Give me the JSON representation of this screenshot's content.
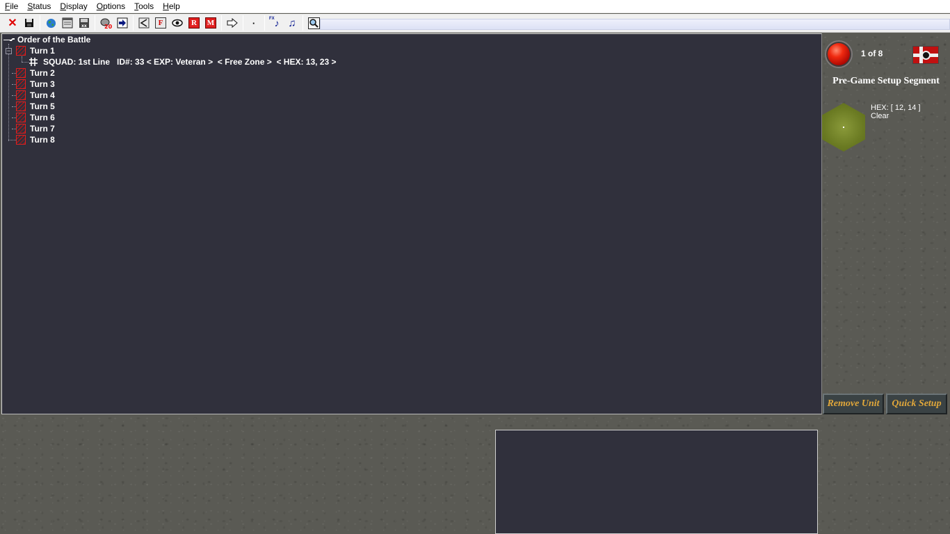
{
  "menu": [
    "File",
    "Status",
    "Display",
    "Options",
    "Tools",
    "Help"
  ],
  "toolbar": {
    "icons": [
      "close-icon",
      "save-icon",
      "globe-icon",
      "window-icon",
      "disk-export-icon",
      "reinforcements-icon",
      "next-arrow-icon",
      "back-icon",
      "fire-icon",
      "eye-icon",
      "rout-icon",
      "move-icon",
      "forward-arrow-icon",
      "dot-icon",
      "sound-fx-icon",
      "music-icon",
      "zoom-icon"
    ],
    "fire_label": "F",
    "rout_label": "R",
    "move_label": "M",
    "dot_label": "·",
    "fx_label": "FX",
    "music_label": "♫"
  },
  "tree": {
    "root": "Order of the Battle",
    "turn1": "Turn 1",
    "unit": "SQUAD: 1st Line   ID#: 33 < EXP: Veteran >  < Free Zone >  < HEX: 13, 23 >",
    "turns": [
      "Turn 2",
      "Turn 3",
      "Turn 4",
      "Turn 5",
      "Turn 6",
      "Turn 7",
      "Turn 8"
    ]
  },
  "side": {
    "turn_counter": "1 of 8",
    "segment": "Pre-Game Setup Segment",
    "hex_line1": "HEX: [ 12, 14 ]",
    "hex_line2": "Clear",
    "remove_unit": "Remove Unit",
    "quick_setup": "Quick Setup"
  },
  "colors": {
    "panel_bg": "#30303c",
    "accent_red": "#e02020",
    "button_gold": "#e0a73a"
  }
}
